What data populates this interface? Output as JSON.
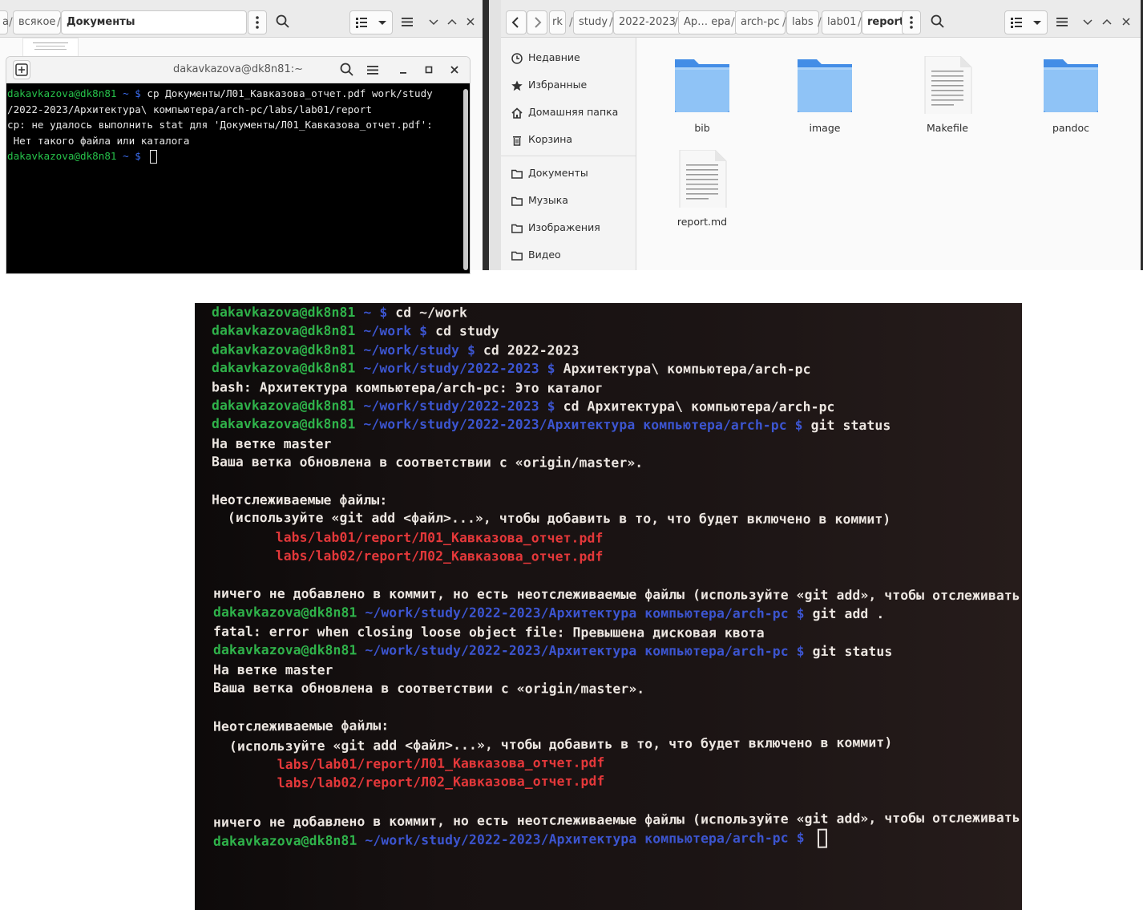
{
  "left_fm": {
    "crumbs": [
      "а",
      "всякое",
      "Документы"
    ],
    "search_icon": "search-icon",
    "view_icon": "list-view-icon"
  },
  "terminal": {
    "title": "dakavkazova@dk8n81:~",
    "lines": [
      [
        {
          "t": "dakavkazova@dk8n81",
          "c": "g"
        },
        {
          "t": " ~ $ ",
          "c": "b"
        },
        {
          "t": "cp Документы/Л01_Кавказова_отчет.pdf work/study",
          "c": "w"
        }
      ],
      [
        {
          "t": "/2022-2023/Архитектура\\ компьютера/arch-pc/labs/lab01/report",
          "c": "w"
        }
      ],
      [
        {
          "t": "cp: не удалось выполнить stat для 'Документы/Л01_Кавказова_отчет.pdf':",
          "c": "w"
        }
      ],
      [
        {
          "t": " Нет такого файла или каталога",
          "c": "w"
        }
      ],
      [
        {
          "t": "dakavkazova@dk8n81",
          "c": "g"
        },
        {
          "t": " ~ $ ",
          "c": "b"
        }
      ]
    ]
  },
  "right_fm": {
    "crumbs": [
      "rk",
      "study",
      "2022-2023",
      "Ар… ера",
      "arch-pc",
      "labs",
      "lab01",
      "report"
    ],
    "sidebar": [
      {
        "label": "Недавние",
        "icon": "clock-icon"
      },
      {
        "label": "Избранные",
        "icon": "star-icon"
      },
      {
        "label": "Домашняя папка",
        "icon": "home-icon"
      },
      {
        "label": "Корзина",
        "icon": "trash-icon"
      },
      {
        "label": "Документы",
        "icon": "folder-icon"
      },
      {
        "label": "Музыка",
        "icon": "folder-icon"
      },
      {
        "label": "Изображения",
        "icon": "folder-icon"
      },
      {
        "label": "Видео",
        "icon": "folder-icon"
      }
    ],
    "files": [
      {
        "name": "bib",
        "kind": "folder"
      },
      {
        "name": "image",
        "kind": "folder"
      },
      {
        "name": "Makefile",
        "kind": "document"
      },
      {
        "name": "pandoc",
        "kind": "folder"
      },
      {
        "name": "report.md",
        "kind": "document"
      }
    ]
  },
  "photo_terminal": {
    "lines": [
      [
        {
          "t": "dakavkazova@dk8n81",
          "c": "g"
        },
        {
          "t": " ~ $ ",
          "c": "b"
        },
        {
          "t": "cd ~/work",
          "c": "w"
        }
      ],
      [
        {
          "t": "dakavkazova@dk8n81",
          "c": "g"
        },
        {
          "t": " ~/work $ ",
          "c": "b"
        },
        {
          "t": "cd study",
          "c": "w"
        }
      ],
      [
        {
          "t": "dakavkazova@dk8n81",
          "c": "g"
        },
        {
          "t": " ~/work/study $ ",
          "c": "b"
        },
        {
          "t": "cd 2022-2023",
          "c": "w"
        }
      ],
      [
        {
          "t": "dakavkazova@dk8n81",
          "c": "g"
        },
        {
          "t": " ~/work/study/2022-2023 $ ",
          "c": "b"
        },
        {
          "t": "Архитектура\\ компьютера/arch-pc",
          "c": "w"
        }
      ],
      [
        {
          "t": "bash: Архитектура компьютера/arch-pc: Это каталог",
          "c": "w"
        }
      ],
      [
        {
          "t": "dakavkazova@dk8n81",
          "c": "g"
        },
        {
          "t": " ~/work/study/2022-2023 $ ",
          "c": "b"
        },
        {
          "t": "cd Архитектура\\ компьютера/arch-pc",
          "c": "w"
        }
      ],
      [
        {
          "t": "dakavkazova@dk8n81",
          "c": "g"
        },
        {
          "t": " ~/work/study/2022-2023/Архитектура компьютера/arch-pc $ ",
          "c": "b"
        },
        {
          "t": "git status",
          "c": "w"
        }
      ],
      [
        {
          "t": "На ветке master",
          "c": "w"
        }
      ],
      [
        {
          "t": "Ваша ветка обновлена в соответствии с «origin/master».",
          "c": "w"
        }
      ],
      [],
      [
        {
          "t": "Неотслеживаемые файлы:",
          "c": "w"
        }
      ],
      [
        {
          "t": "  (используйте «git add <файл>...», чтобы добавить в то, что будет включено в коммит)",
          "c": "w"
        }
      ],
      [
        {
          "t": "        labs/lab01/report/Л01_Кавказова_отчет.pdf",
          "c": "r"
        }
      ],
      [
        {
          "t": "        labs/lab02/report/Л02_Кавказова_отчет.pdf",
          "c": "r"
        }
      ],
      [],
      [
        {
          "t": "ничего не добавлено в коммит, но есть неотслеживаемые файлы (используйте «git add», чтобы отслеживать их)",
          "c": "w"
        }
      ],
      [
        {
          "t": "dakavkazova@dk8n81",
          "c": "g"
        },
        {
          "t": " ~/work/study/2022-2023/Архитектура компьютера/arch-pc $ ",
          "c": "b"
        },
        {
          "t": "git add .",
          "c": "w"
        }
      ],
      [
        {
          "t": "fatal: error when closing loose object file: Превышена дисковая квота",
          "c": "w"
        }
      ],
      [
        {
          "t": "dakavkazova@dk8n81",
          "c": "g"
        },
        {
          "t": " ~/work/study/2022-2023/Архитектура компьютера/arch-pc $ ",
          "c": "b"
        },
        {
          "t": "git status",
          "c": "w"
        }
      ],
      [
        {
          "t": "На ветке master",
          "c": "w"
        }
      ],
      [
        {
          "t": "Ваша ветка обновлена в соответствии с «origin/master».",
          "c": "w"
        }
      ],
      [],
      [
        {
          "t": "Неотслеживаемые файлы:",
          "c": "w"
        }
      ],
      [
        {
          "t": "  (используйте «git add <файл>...», чтобы добавить в то, что будет включено в коммит)",
          "c": "w"
        }
      ],
      [
        {
          "t": "        labs/lab01/report/Л01_Кавказова_отчет.pdf",
          "c": "r"
        }
      ],
      [
        {
          "t": "        labs/lab02/report/Л02_Кавказова_отчет.pdf",
          "c": "r"
        }
      ],
      [],
      [
        {
          "t": "ничего не добавлено в коммит, но есть неотслеживаемые файлы (используйте «git add», чтобы отслеживать их)",
          "c": "w"
        }
      ],
      [
        {
          "t": "dakavkazova@dk8n81",
          "c": "g"
        },
        {
          "t": " ~/work/study/2022-2023/Архитектура компьютера/arch-pc $ ",
          "c": "b"
        }
      ]
    ]
  }
}
